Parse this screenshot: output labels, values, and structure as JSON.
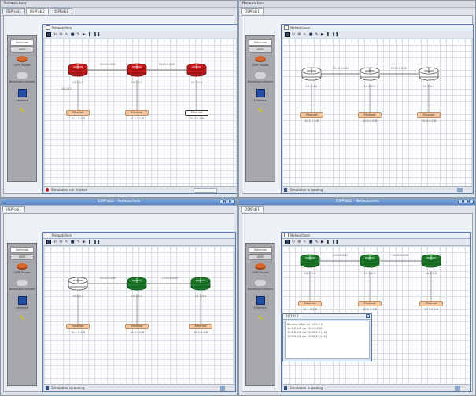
{
  "colors": {
    "red": "#c21a1a",
    "green": "#1e7a2a",
    "white": "#ffffff",
    "interface": "#f2c7a4",
    "link": "#777777"
  },
  "palette": {
    "top": "Selection",
    "top2": "UIMS",
    "items": [
      {
        "icon": "router-icon",
        "label": "OSPF Router"
      },
      {
        "icon": "cloud-icon",
        "label": "Broadcast network"
      },
      {
        "icon": "interface-icon",
        "label": "Interface"
      },
      {
        "icon": "pen-icon",
        "label": ""
      }
    ]
  },
  "toolbar": [
    "grid-icon",
    "refresh-icon",
    "settings-icon",
    "select-icon",
    "stop-icon",
    "edit-icon",
    "play-icon",
    "step-icon",
    "pause-icon"
  ],
  "routers": [
    {
      "label": "10.1.0.2",
      "ifbox": "Ethernet",
      "ifip": "10.1.0.2/8"
    },
    {
      "label": "10.2.0.2",
      "ifbox": "Ethernet",
      "ifip": "10.2.0.2/8"
    },
    {
      "label": "10.3.0.2",
      "ifbox": "Ethernet",
      "ifip": "10.3.0.2/8"
    }
  ],
  "links": [
    {
      "label": "10.10.0.0/30"
    },
    {
      "label": "10.20.0.0/30"
    }
  ],
  "panels": [
    {
      "titlebar": "Netwatchers",
      "tabs": [
        {
          "label": "OSPFobj1",
          "active": false
        },
        {
          "label": "OSPFobj2",
          "active": true
        },
        {
          "label": "OSPFobj3",
          "active": false
        }
      ],
      "canvas_title": "Netwatchers",
      "router_states": [
        "red",
        "red",
        "red"
      ],
      "status_text": "Simulation run finished",
      "status_icon": "error"
    },
    {
      "titlebar": "Netwatchers",
      "tabs": [
        {
          "label": "OSPFobj1",
          "active": true
        }
      ],
      "canvas_title": "Netwatchers",
      "router_states": [
        "white",
        "white",
        "white"
      ],
      "status_text": "Simulation is running",
      "status_icon": "ok"
    },
    {
      "titlebar": "OSPFobj1 - Netwatchers",
      "tabs": [
        {
          "label": "OSPFobj1",
          "active": true
        }
      ],
      "canvas_title": "Netwatchers",
      "router_states": [
        "white",
        "green",
        "green"
      ],
      "status_text": "Simulation is running",
      "status_icon": "ok"
    },
    {
      "titlebar": "OSPFobj1 - Netwatchers",
      "tabs": [
        {
          "label": "OSPFobj1",
          "active": true
        }
      ],
      "canvas_title": "Netwatchers",
      "router_states": [
        "green",
        "green",
        "green"
      ],
      "status_text": "Simulation is running",
      "status_icon": "ok",
      "popup": {
        "title": "10.1.0.2",
        "lines": [
          "Routing table for 10.1.0.2:",
          "10.1.0.0/8 via 10.1.0.2 (0)",
          "10.2.0.0/8 via 10.10.0.2 (10)",
          "10.3.0.0/8 via 10.10.0.2 (20)"
        ]
      }
    }
  ]
}
